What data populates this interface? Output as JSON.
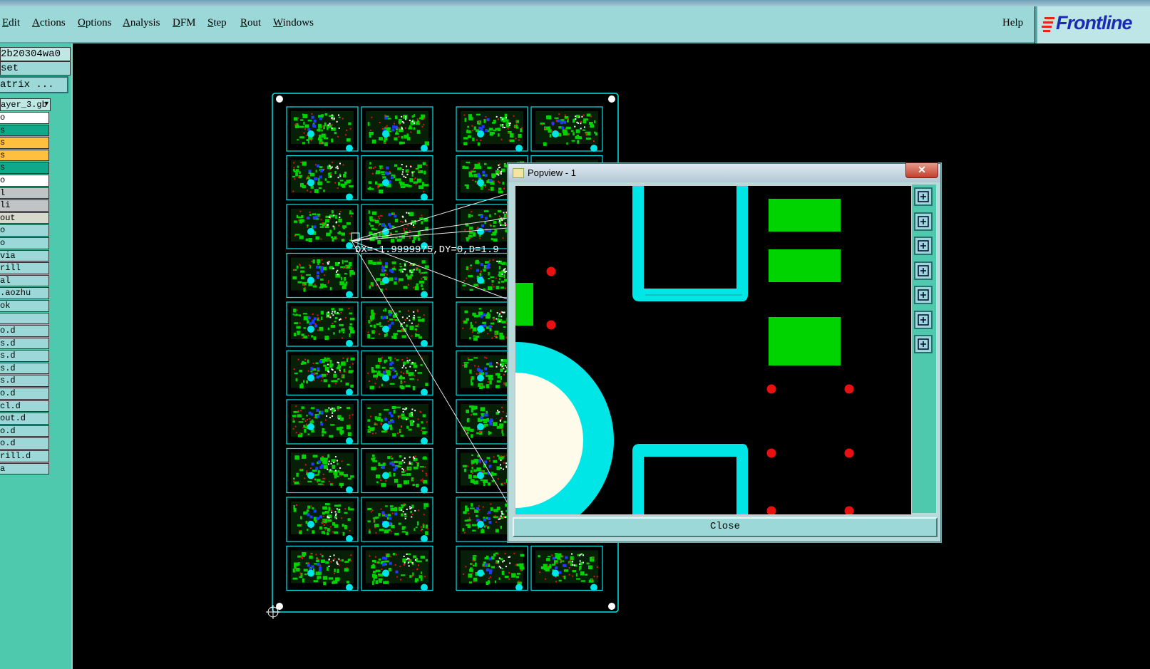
{
  "menu": {
    "items": [
      {
        "label": "Edit",
        "ul": "E",
        "rest": "dit"
      },
      {
        "label": "Actions",
        "ul": "A",
        "rest": "ctions"
      },
      {
        "label": "Options",
        "ul": "O",
        "rest": "ptions"
      },
      {
        "label": "Analysis",
        "ul": "A",
        "rest": "nalysis"
      },
      {
        "label": "DFM",
        "ul": "D",
        "rest": "FM"
      },
      {
        "label": "Step",
        "ul": "S",
        "rest": "tep"
      },
      {
        "label": "Rout",
        "ul": "R",
        "rest": "out"
      },
      {
        "label": "Windows",
        "ul": "W",
        "rest": "indows"
      }
    ],
    "help": "Help"
  },
  "logo": {
    "text": "Frontline",
    "mark_color": "#e8241c",
    "text_color": "#1a2bb5"
  },
  "left_panel": {
    "job": "2b20304wa0",
    "step": "set",
    "matrix_button": "atrix ...",
    "active_layer": "ayer_3.gb",
    "layers": [
      {
        "label": "o",
        "bg": "#ffffff"
      },
      {
        "label": "s",
        "bg": "#11a88a"
      },
      {
        "label": "s",
        "bg": "#ffbf40"
      },
      {
        "label": "s",
        "bg": "#ffbf40"
      },
      {
        "label": "s",
        "bg": "#11a88a"
      },
      {
        "label": "o",
        "bg": "#ffffff"
      },
      {
        "label": "l",
        "bg": "#c0c4c4"
      },
      {
        "label": "li",
        "bg": "#c0c4c4"
      },
      {
        "label": "out",
        "bg": "#d8d8cc"
      },
      {
        "label": "o",
        "bg": "#9cd8d8"
      },
      {
        "label": "o",
        "bg": "#9cd8d8"
      },
      {
        "label": "via",
        "bg": "#9cd8d8"
      },
      {
        "label": "rill",
        "bg": "#9cd8d8"
      },
      {
        "label": "al",
        "bg": "#9cd8d8"
      },
      {
        "label": ".aozhu",
        "bg": "#9cd8d8"
      },
      {
        "label": "ok",
        "bg": "#9cd8d8"
      },
      {
        "label": "",
        "bg": "#9cd8d8"
      },
      {
        "label": "o.d",
        "bg": "#9cd8d8"
      },
      {
        "label": "s.d",
        "bg": "#9cd8d8"
      },
      {
        "label": "s.d",
        "bg": "#9cd8d8"
      },
      {
        "label": "s.d",
        "bg": "#9cd8d8"
      },
      {
        "label": "s.d",
        "bg": "#9cd8d8"
      },
      {
        "label": "o.d",
        "bg": "#9cd8d8"
      },
      {
        "label": "cl.d",
        "bg": "#9cd8d8"
      },
      {
        "label": "out.d",
        "bg": "#9cd8d8"
      },
      {
        "label": "o.d",
        "bg": "#9cd8d8"
      },
      {
        "label": "o.d",
        "bg": "#9cd8d8"
      },
      {
        "label": "rill.d",
        "bg": "#9cd8d8"
      },
      {
        "label": "a",
        "bg": "#9cd8d8"
      }
    ]
  },
  "canvas": {
    "measure_readout": "DX=-1.9999975,DY=0,D=1.9",
    "colors": {
      "outline": "#00e5e5",
      "copper": "#00d400",
      "pad": "#e81010",
      "via": "#1f3cff",
      "hole": "#fffbea"
    }
  },
  "popview": {
    "title": "Popview - 1",
    "close_x": "✕",
    "close_button": "Close",
    "tools": [
      "zoom-window-icon",
      "pan-up-icon",
      "pan-down-icon",
      "pan-left-icon",
      "pan-right-icon",
      "zoom-fit-icon",
      "zoom-home-icon"
    ]
  }
}
